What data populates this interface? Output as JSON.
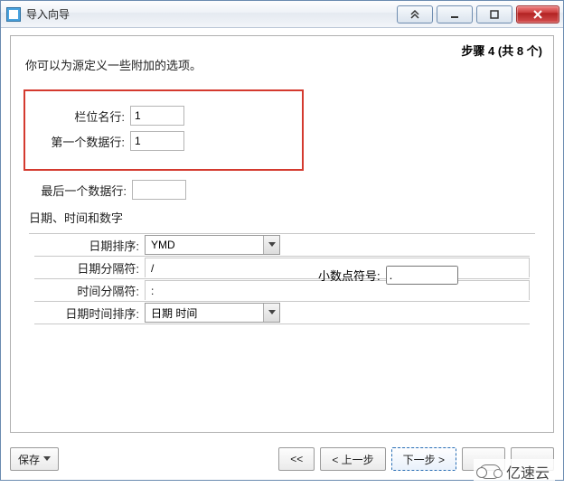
{
  "window": {
    "title": "导入向导",
    "step_label": "步骤 4 (共 8 个)",
    "intro": "你可以为源定义一些附加的选项。"
  },
  "rows": {
    "field_name_row": {
      "label": "栏位名行:",
      "value": "1"
    },
    "first_data_row": {
      "label": "第一个数据行:",
      "value": "1"
    },
    "last_data_row": {
      "label": "最后一个数据行:",
      "value": ""
    }
  },
  "datetime_section": {
    "heading": "日期、时间和数字",
    "date_order": {
      "label": "日期排序:",
      "value": "YMD"
    },
    "date_sep": {
      "label": "日期分隔符:",
      "value": "/"
    },
    "time_sep": {
      "label": "时间分隔符:",
      "value": ":"
    },
    "datetime_order": {
      "label": "日期时间排序:",
      "value": "日期 时间"
    },
    "decimal_symbol": {
      "label": "小数点符号:",
      "value": "."
    }
  },
  "footer": {
    "save": "保存",
    "first": "<<",
    "prev": "< 上一步",
    "next": "下一步 >",
    "last_hidden_1": "",
    "last_hidden_2": ""
  },
  "watermark": "亿速云"
}
